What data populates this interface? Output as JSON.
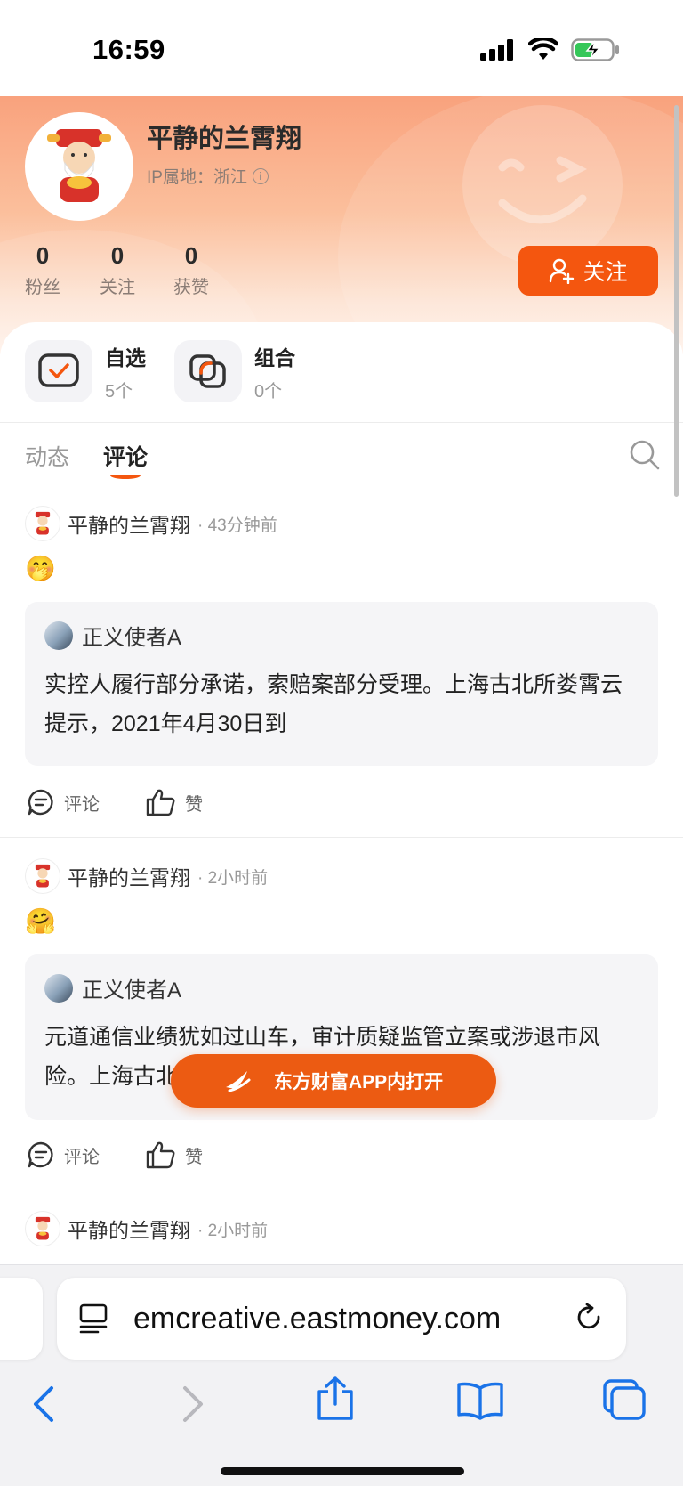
{
  "status_bar": {
    "time": "16:59"
  },
  "profile": {
    "username": "平静的兰霄翔",
    "ip_location": "IP属地：浙江",
    "stats": [
      {
        "value": "0",
        "label": "粉丝"
      },
      {
        "value": "0",
        "label": "关注"
      },
      {
        "value": "0",
        "label": "获赞"
      }
    ],
    "follow_label": "关注"
  },
  "quick_links": [
    {
      "title": "自选",
      "count": "5个"
    },
    {
      "title": "组合",
      "count": "0个"
    }
  ],
  "tabs": [
    {
      "label": "动态",
      "active": false
    },
    {
      "label": "评论",
      "active": true
    }
  ],
  "posts": [
    {
      "author": "平静的兰霄翔",
      "time": "· 43分钟前",
      "emoji": "🤭",
      "quote_author": "正义使者A",
      "quote_text": "实控人履行部分承诺，索赔案部分受理。上海古北所娄霄云提示，2021年4月30日到",
      "comment_label": "评论",
      "like_label": "赞"
    },
    {
      "author": "平静的兰霄翔",
      "time": "· 2小时前",
      "emoji": "🤗",
      "quote_author": "正义使者A",
      "quote_text": "元道通信业绩犹如过山车，审计质疑监管立案或涉退市风险。上海古北所娄霄云提示",
      "comment_label": "评论",
      "like_label": "赞"
    },
    {
      "author": "平静的兰霄翔",
      "time": "· 2小时前"
    }
  ],
  "open_app_label": "东方财富APP内打开",
  "browser": {
    "url": "emcreative.eastmoney.com"
  },
  "colors": {
    "accent": "#f4560f",
    "header_gradient_top": "#f9a27d"
  }
}
